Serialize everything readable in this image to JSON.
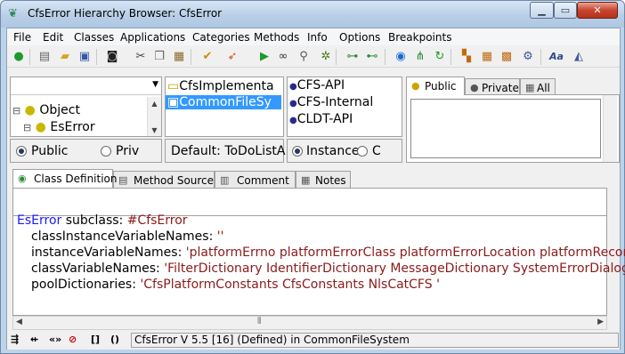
{
  "window": {
    "title": "CfsError Hierarchy Browser: CfsError"
  },
  "menu": [
    "File",
    "Edit",
    "Classes",
    "Applications",
    "Categories",
    "Methods",
    "Info",
    "Options",
    "Breakpoints"
  ],
  "toolbar": {
    "icons": [
      "run-icon",
      "new-icon",
      "open-icon",
      "save-icon",
      "camera-icon",
      "cut-icon",
      "copy-icon",
      "paste-icon",
      "check-icon",
      "rocket-icon",
      "play-icon",
      "glasses-icon",
      "magnifier-icon",
      "bug-icon",
      "hierarchy-icon",
      "hierarchy2-icon",
      "globe-icon",
      "tree-icon",
      "refresh-icon",
      "class-icon",
      "grid-icon",
      "grid2-icon",
      "settings-icon",
      "font-icon",
      "paint-icon"
    ]
  },
  "class_pane": {
    "dropdown_value": "",
    "items": [
      {
        "toggle": "⊟",
        "label": "Object"
      },
      {
        "toggle": "⊟",
        "label": "EsError"
      }
    ]
  },
  "app_pane": {
    "items": [
      {
        "label": "CfsImplementa"
      },
      {
        "label": "CommonFileSy"
      }
    ]
  },
  "category_pane": {
    "items": [
      "CFS-API",
      "CFS-Internal",
      "CLDT-API"
    ]
  },
  "method_tabs": [
    "Public",
    "Private",
    "All"
  ],
  "scope_radios": {
    "public": "Public",
    "private": "Priv"
  },
  "default_label": "Default: ToDoListA",
  "side_radios": {
    "instance": "Instance",
    "class": "C"
  },
  "editor_tabs": [
    "Class Definition",
    "Method Source",
    "Comment",
    "Notes"
  ],
  "code": {
    "superclass": "EsError",
    "subclass_kw": "subclass:",
    "subclass_sym": "#CfsError",
    "line2_kw": "classInstanceVariableNames:",
    "line2_str": "''",
    "line3_kw": "instanceVariableNames:",
    "line3_str": "'platformErrno platformErrorClass platformErrorLocation platformRecor",
    "line4_kw": "classVariableNames:",
    "line4_str": "'FilterDictionary IdentifierDictionary MessageDictionary SystemErrorDialog '",
    "line5_kw": "poolDictionaries:",
    "line5_str": "'CfsPlatformConstants CfsConstants NlsCatCFS '"
  },
  "status": {
    "icons": [
      "indent-icon",
      "outdent-icon",
      "quote-icon",
      "disable-icon",
      "brackets-icon",
      "parens-icon"
    ],
    "text": "CfsError V 5.5  [16] (Defined) in CommonFileSystem"
  }
}
